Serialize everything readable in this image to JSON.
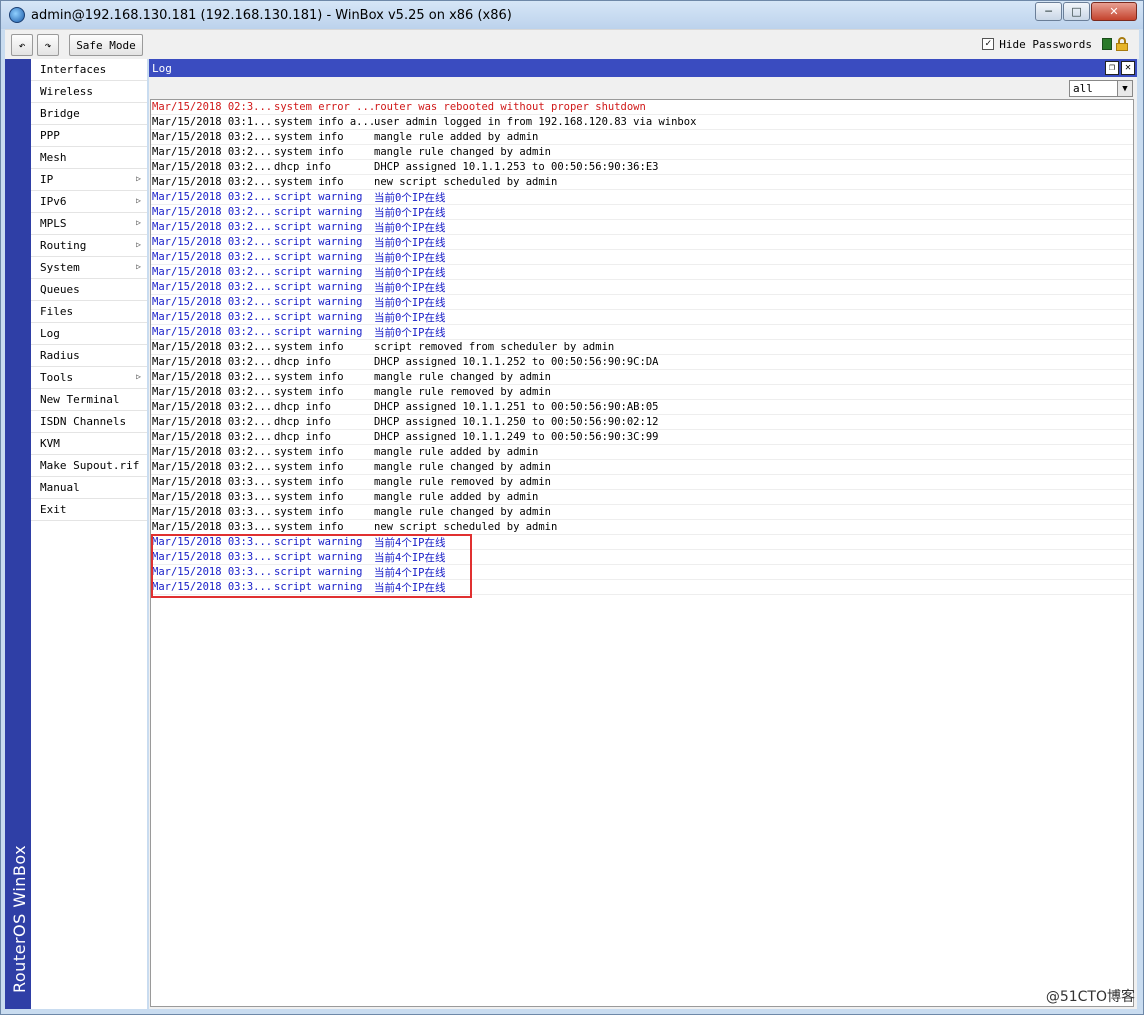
{
  "window": {
    "title": "admin@192.168.130.181 (192.168.130.181) - WinBox v5.25 on x86 (x86)",
    "minimize": "─",
    "maximize": "□",
    "close": "✕"
  },
  "toolbar": {
    "undo": "↶",
    "redo": "↷",
    "safe_mode": "Safe Mode",
    "hide_passwords": "Hide Passwords",
    "hide_passwords_checked": "✓"
  },
  "brand": "RouterOS WinBox",
  "sidebar": {
    "items": [
      {
        "label": "Interfaces",
        "submenu": false
      },
      {
        "label": "Wireless",
        "submenu": false
      },
      {
        "label": "Bridge",
        "submenu": false
      },
      {
        "label": "PPP",
        "submenu": false
      },
      {
        "label": "Mesh",
        "submenu": false
      },
      {
        "label": "IP",
        "submenu": true
      },
      {
        "label": "IPv6",
        "submenu": true
      },
      {
        "label": "MPLS",
        "submenu": true
      },
      {
        "label": "Routing",
        "submenu": true
      },
      {
        "label": "System",
        "submenu": true
      },
      {
        "label": "Queues",
        "submenu": false
      },
      {
        "label": "Files",
        "submenu": false
      },
      {
        "label": "Log",
        "submenu": false
      },
      {
        "label": "Radius",
        "submenu": false
      },
      {
        "label": "Tools",
        "submenu": true
      },
      {
        "label": "New Terminal",
        "submenu": false
      },
      {
        "label": "ISDN Channels",
        "submenu": false
      },
      {
        "label": "KVM",
        "submenu": false
      },
      {
        "label": "Make Supout.rif",
        "submenu": false
      },
      {
        "label": "Manual",
        "submenu": false
      },
      {
        "label": "Exit",
        "submenu": false
      }
    ],
    "arrow": "▷"
  },
  "log": {
    "title": "Log",
    "restore": "❐",
    "close": "✕",
    "filter_value": "all",
    "filter_arrow": "▼",
    "rows": [
      {
        "time": "Mar/15/2018 02:3...",
        "topic": "system error ...",
        "msg": "router was rebooted without proper shutdown",
        "level": "error"
      },
      {
        "time": "Mar/15/2018 03:1...",
        "topic": "system info a...",
        "msg": "user admin logged in from 192.168.120.83 via winbox",
        "level": "info"
      },
      {
        "time": "Mar/15/2018 03:2...",
        "topic": "system info",
        "msg": "mangle rule added by admin",
        "level": "info"
      },
      {
        "time": "Mar/15/2018 03:2...",
        "topic": "system info",
        "msg": "mangle rule changed by admin",
        "level": "info"
      },
      {
        "time": "Mar/15/2018 03:2...",
        "topic": "dhcp info",
        "msg": "DHCP assigned 10.1.1.253 to 00:50:56:90:36:E3",
        "level": "info"
      },
      {
        "time": "Mar/15/2018 03:2...",
        "topic": "system info",
        "msg": "new script scheduled by admin",
        "level": "info"
      },
      {
        "time": "Mar/15/2018 03:2...",
        "topic": "script warning",
        "msg": "当前0个IP在线",
        "level": "warning"
      },
      {
        "time": "Mar/15/2018 03:2...",
        "topic": "script warning",
        "msg": "当前0个IP在线",
        "level": "warning"
      },
      {
        "time": "Mar/15/2018 03:2...",
        "topic": "script warning",
        "msg": "当前0个IP在线",
        "level": "warning"
      },
      {
        "time": "Mar/15/2018 03:2...",
        "topic": "script warning",
        "msg": "当前0个IP在线",
        "level": "warning"
      },
      {
        "time": "Mar/15/2018 03:2...",
        "topic": "script warning",
        "msg": "当前0个IP在线",
        "level": "warning"
      },
      {
        "time": "Mar/15/2018 03:2...",
        "topic": "script warning",
        "msg": "当前0个IP在线",
        "level": "warning"
      },
      {
        "time": "Mar/15/2018 03:2...",
        "topic": "script warning",
        "msg": "当前0个IP在线",
        "level": "warning"
      },
      {
        "time": "Mar/15/2018 03:2...",
        "topic": "script warning",
        "msg": "当前0个IP在线",
        "level": "warning"
      },
      {
        "time": "Mar/15/2018 03:2...",
        "topic": "script warning",
        "msg": "当前0个IP在线",
        "level": "warning"
      },
      {
        "time": "Mar/15/2018 03:2...",
        "topic": "script warning",
        "msg": "当前0个IP在线",
        "level": "warning"
      },
      {
        "time": "Mar/15/2018 03:2...",
        "topic": "system info",
        "msg": "script removed from scheduler by admin",
        "level": "info"
      },
      {
        "time": "Mar/15/2018 03:2...",
        "topic": "dhcp info",
        "msg": "DHCP assigned 10.1.1.252 to 00:50:56:90:9C:DA",
        "level": "info"
      },
      {
        "time": "Mar/15/2018 03:2...",
        "topic": "system info",
        "msg": "mangle rule changed by admin",
        "level": "info"
      },
      {
        "time": "Mar/15/2018 03:2...",
        "topic": "system info",
        "msg": "mangle rule removed by admin",
        "level": "info"
      },
      {
        "time": "Mar/15/2018 03:2...",
        "topic": "dhcp info",
        "msg": "DHCP assigned 10.1.1.251 to 00:50:56:90:AB:05",
        "level": "info"
      },
      {
        "time": "Mar/15/2018 03:2...",
        "topic": "dhcp info",
        "msg": "DHCP assigned 10.1.1.250 to 00:50:56:90:02:12",
        "level": "info"
      },
      {
        "time": "Mar/15/2018 03:2...",
        "topic": "dhcp info",
        "msg": "DHCP assigned 10.1.1.249 to 00:50:56:90:3C:99",
        "level": "info"
      },
      {
        "time": "Mar/15/2018 03:2...",
        "topic": "system info",
        "msg": "mangle rule added by admin",
        "level": "info"
      },
      {
        "time": "Mar/15/2018 03:2...",
        "topic": "system info",
        "msg": "mangle rule changed by admin",
        "level": "info"
      },
      {
        "time": "Mar/15/2018 03:3...",
        "topic": "system info",
        "msg": "mangle rule removed by admin",
        "level": "info"
      },
      {
        "time": "Mar/15/2018 03:3...",
        "topic": "system info",
        "msg": "mangle rule added by admin",
        "level": "info"
      },
      {
        "time": "Mar/15/2018 03:3...",
        "topic": "system info",
        "msg": "mangle rule changed by admin",
        "level": "info"
      },
      {
        "time": "Mar/15/2018 03:3...",
        "topic": "system info",
        "msg": "new script scheduled by admin",
        "level": "info"
      },
      {
        "time": "Mar/15/2018 03:3...",
        "topic": "script warning",
        "msg": "当前4个IP在线",
        "level": "warning"
      },
      {
        "time": "Mar/15/2018 03:3...",
        "topic": "script warning",
        "msg": "当前4个IP在线",
        "level": "warning"
      },
      {
        "time": "Mar/15/2018 03:3...",
        "topic": "script warning",
        "msg": "当前4个IP在线",
        "level": "warning"
      },
      {
        "time": "Mar/15/2018 03:3...",
        "topic": "script warning",
        "msg": "当前4个IP在线",
        "level": "warning"
      }
    ]
  },
  "watermark": "@51CTO博客",
  "colors": {
    "error": "#d01818",
    "warning": "#1a20c8",
    "info": "#000000",
    "brand_strip": "#2f3fa6",
    "log_titlebar": "#3a4cc0",
    "highlight": "#e03030"
  }
}
